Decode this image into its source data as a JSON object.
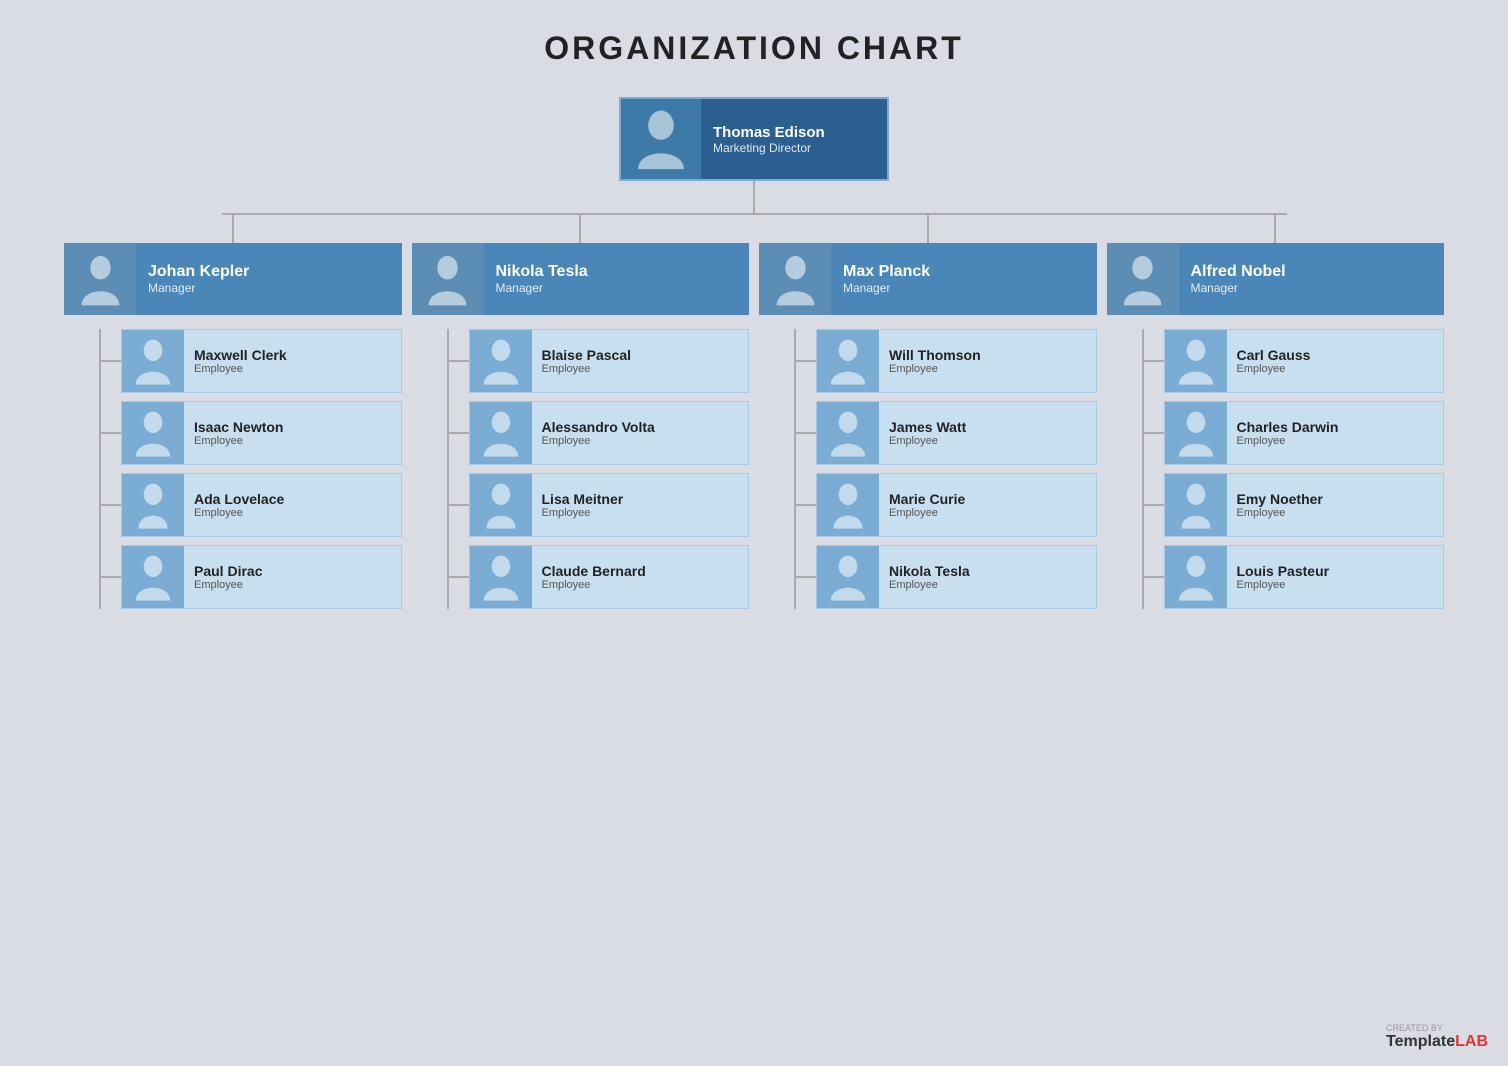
{
  "title": "ORGANIZATION CHART",
  "root": {
    "name": "Thomas Edison",
    "role": "Marketing Director"
  },
  "managers": [
    {
      "name": "Johan Kepler",
      "role": "Manager",
      "employees": [
        {
          "name": "Maxwell Clerk",
          "role": "Employee",
          "gender": "male"
        },
        {
          "name": "Isaac Newton",
          "role": "Employee",
          "gender": "male"
        },
        {
          "name": "Ada Lovelace",
          "role": "Employee",
          "gender": "female"
        },
        {
          "name": "Paul Dirac",
          "role": "Employee",
          "gender": "male"
        }
      ]
    },
    {
      "name": "Nikola Tesla",
      "role": "Manager",
      "employees": [
        {
          "name": "Blaise Pascal",
          "role": "Employee",
          "gender": "male"
        },
        {
          "name": "Alessandro Volta",
          "role": "Employee",
          "gender": "male"
        },
        {
          "name": "Lisa Meitner",
          "role": "Employee",
          "gender": "female"
        },
        {
          "name": "Claude Bernard",
          "role": "Employee",
          "gender": "male"
        }
      ]
    },
    {
      "name": "Max Planck",
      "role": "Manager",
      "employees": [
        {
          "name": "Will Thomson",
          "role": "Employee",
          "gender": "male"
        },
        {
          "name": "James Watt",
          "role": "Employee",
          "gender": "male"
        },
        {
          "name": "Marie Curie",
          "role": "Employee",
          "gender": "female"
        },
        {
          "name": "Nikola Tesla",
          "role": "Employee",
          "gender": "male"
        }
      ]
    },
    {
      "name": "Alfred Nobel",
      "role": "Manager",
      "employees": [
        {
          "name": "Carl Gauss",
          "role": "Employee",
          "gender": "male"
        },
        {
          "name": "Charles Darwin",
          "role": "Employee",
          "gender": "male"
        },
        {
          "name": "Emy Noether",
          "role": "Employee",
          "gender": "female"
        },
        {
          "name": "Louis Pasteur",
          "role": "Employee",
          "gender": "male"
        }
      ]
    }
  ],
  "watermark": {
    "created_by": "CREATED BY",
    "brand_part1": "Template",
    "brand_part2": "LAB"
  },
  "colors": {
    "bg": "#d9dde3",
    "root_bg": "#2a5f8f",
    "manager_bg": "#4a86b8",
    "employee_bg": "#c8dff0",
    "connector": "#aaa",
    "title": "#222"
  }
}
